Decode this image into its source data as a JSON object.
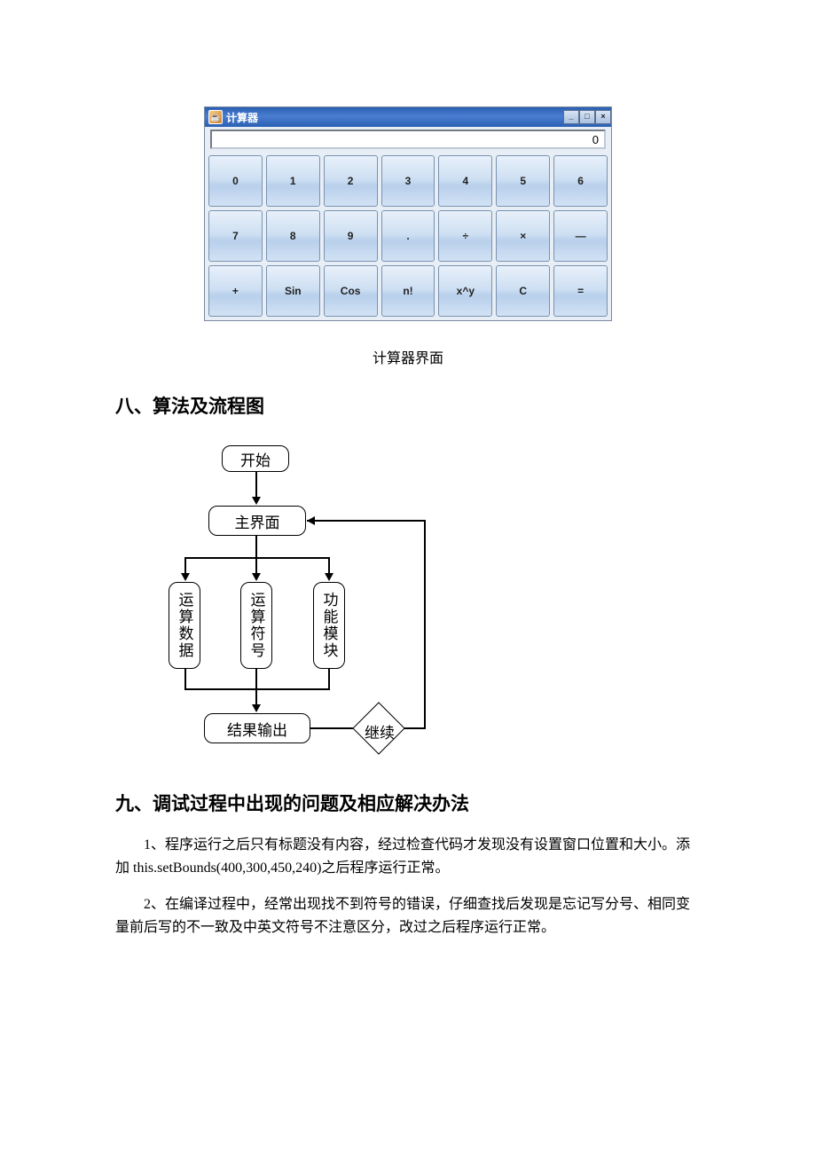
{
  "calculator": {
    "title": "计算器",
    "display_value": "0",
    "window_controls": {
      "min": "_",
      "max": "□",
      "close": "×"
    },
    "buttons": [
      [
        "0",
        "1",
        "2",
        "3",
        "4",
        "5",
        "6"
      ],
      [
        "7",
        "8",
        "9",
        ".",
        "÷",
        "×",
        "—"
      ],
      [
        "+",
        "Sin",
        "Cos",
        "n!",
        "x^y",
        "C",
        "="
      ]
    ]
  },
  "caption_calc": "计算器界面",
  "section8_heading": "八、算法及流程图",
  "flowchart": {
    "start": "开始",
    "main_ui": "主界面",
    "node_data": "运算数据",
    "node_oper": "运算符号",
    "node_func": "功能模块",
    "result": "结果输出",
    "continue": "继续"
  },
  "section9_heading": "九、调试过程中出现的问题及相应解决办法",
  "paragraphs": {
    "p1_a": "1、程序运行之后只有标题没有内容，经过检查代码才发现没有设置窗口位置和大小。添加 ",
    "p1_code": "this.setBounds(400,300,450,240)",
    "p1_b": "之后程序运行正常。",
    "p2": "2、在编译过程中，经常出现找不到符号的错误，仔细查找后发现是忘记写分号、相同变量前后写的不一致及中英文符号不注意区分，改过之后程序运行正常。"
  }
}
